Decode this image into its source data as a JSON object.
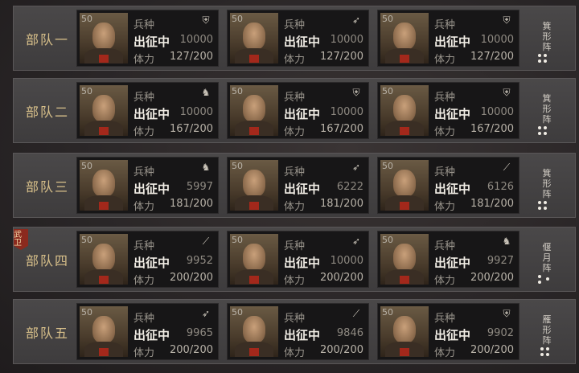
{
  "labels": {
    "type_key": "兵种",
    "status": "出征中",
    "stamina_key": "体力"
  },
  "rows": [
    {
      "name": "部队一",
      "formation": "箕形阵",
      "cards": [
        {
          "level": "50",
          "type": "shield",
          "troops": "10000",
          "stamina": "127/200"
        },
        {
          "level": "50",
          "type": "bow",
          "troops": "10000",
          "stamina": "127/200"
        },
        {
          "level": "50",
          "type": "shield",
          "troops": "10000",
          "stamina": "127/200"
        }
      ]
    },
    {
      "name": "部队二",
      "formation": "箕形阵",
      "cards": [
        {
          "level": "50",
          "type": "horse",
          "troops": "10000",
          "stamina": "167/200"
        },
        {
          "level": "50",
          "type": "shield",
          "troops": "10000",
          "stamina": "167/200"
        },
        {
          "level": "50",
          "type": "shield",
          "troops": "10000",
          "stamina": "167/200"
        }
      ]
    },
    {
      "name": "部队三",
      "formation": "箕形阵",
      "cards": [
        {
          "level": "50",
          "type": "horse",
          "troops": "5997",
          "stamina": "181/200"
        },
        {
          "level": "50",
          "type": "bow",
          "troops": "6222",
          "stamina": "181/200"
        },
        {
          "level": "50",
          "type": "spear",
          "troops": "6126",
          "stamina": "181/200"
        }
      ]
    },
    {
      "name": "部队四",
      "badge": "武卫",
      "formation": "偃月阵",
      "cards": [
        {
          "level": "50",
          "type": "spear",
          "troops": "9952",
          "stamina": "200/200"
        },
        {
          "level": "50",
          "type": "bow",
          "troops": "10000",
          "stamina": "200/200"
        },
        {
          "level": "50",
          "type": "horse",
          "troops": "9927",
          "stamina": "200/200"
        }
      ]
    },
    {
      "name": "部队五",
      "formation": "雁形阵",
      "cards": [
        {
          "level": "50",
          "type": "bow",
          "troops": "9965",
          "stamina": "200/200"
        },
        {
          "level": "50",
          "type": "spear",
          "troops": "9846",
          "stamina": "200/200"
        },
        {
          "level": "50",
          "type": "shield",
          "troops": "9902",
          "stamina": "200/200"
        }
      ]
    }
  ],
  "colors": {
    "label_gold": "#d8c08a",
    "card_bg": "#171617",
    "badge_red": "#8b2a1e"
  }
}
